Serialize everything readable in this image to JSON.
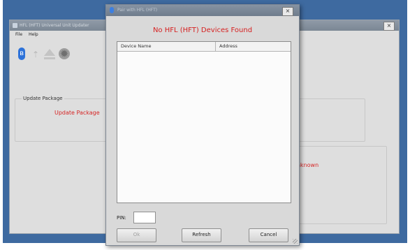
{
  "main_window": {
    "title": "HFL (HFT) Universal Unit Updater",
    "close_glyph": "×",
    "menu": [
      "File",
      "Help"
    ],
    "toolbar_icons": [
      "bluetooth-icon",
      "usb-icon",
      "eject-icon",
      "gear-icon"
    ],
    "update_group_label": "Update Package",
    "update_status_text": "Update Package",
    "device_status_text": "Unknown"
  },
  "dialog": {
    "title": "Pair with HFL (HFT)",
    "close_glyph": "×",
    "status_message": "No HFL (HFT) Devices Found",
    "columns": {
      "name": "Device Name",
      "address": "Address"
    },
    "devices": [],
    "pin_label": "PIN:",
    "pin_value": "",
    "buttons": {
      "ok": "Ok",
      "refresh": "Refresh",
      "cancel": "Cancel"
    }
  },
  "colors": {
    "desktop": "#3e6aa0",
    "error_text": "#d62020",
    "window_bg": "#dedede"
  }
}
